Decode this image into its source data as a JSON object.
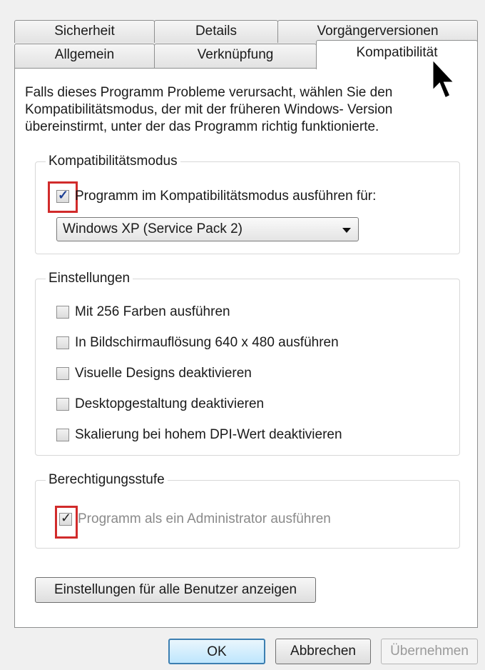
{
  "tabs": {
    "row1": [
      "Sicherheit",
      "Details",
      "Vorgängerversionen"
    ],
    "row2": [
      "Allgemein",
      "Verknüpfung",
      "Kompatibilität"
    ]
  },
  "intro": "Falls dieses Programm Probleme verursacht, wählen Sie den Kompatibilitätsmodus, der mit der früheren Windows- Version übereinstirmt, unter der das Programm richtig funktionierte.",
  "compat": {
    "title": "Kompatibilitätsmodus",
    "checkbox_label": "Programm im Kompatibilitätsmodus ausführen für:",
    "checked": true,
    "selected": "Windows XP (Service Pack 2)"
  },
  "settings": {
    "title": "Einstellungen",
    "options": [
      "Mit 256 Farben ausführen",
      "In Bildschirmauflösung 640 x 480 ausführen",
      "Visuelle Designs deaktivieren",
      "Desktopgestaltung deaktivieren",
      "Skalierung bei hohem DPI-Wert deaktivieren"
    ]
  },
  "privilege": {
    "title": "Berechtigungsstufe",
    "checkbox_label": "Programm als ein Administrator ausführen",
    "checked": true
  },
  "all_users_button": "Einstellungen für alle Benutzer anzeigen",
  "buttons": {
    "ok": "OK",
    "cancel": "Abbrechen",
    "apply": "Übernehmen"
  },
  "colors": {
    "highlight": "#d12b2b",
    "panel": "#ffffff",
    "dialog": "#f0f0f0"
  }
}
